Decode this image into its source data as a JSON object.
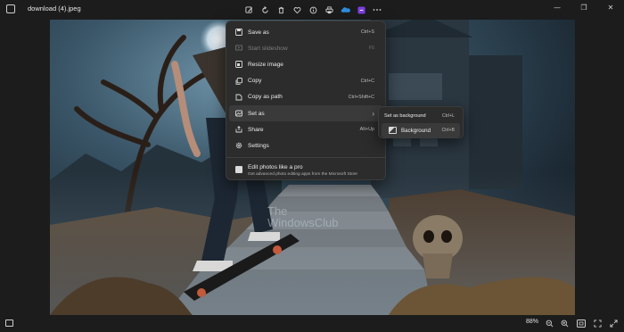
{
  "window": {
    "file_title": "download (4).jpeg",
    "controls": [
      "—",
      "❐",
      "✕"
    ]
  },
  "toolbar": {
    "buttons": [
      "edit-icon",
      "rotate-icon",
      "delete-icon",
      "favorite-icon",
      "info-icon",
      "print-icon",
      "onedrive-icon",
      "clipchamp-icon",
      "more-icon"
    ]
  },
  "menu": {
    "items": [
      {
        "label": "Save as",
        "shortcut": "Ctrl+S",
        "icon": "save-icon"
      },
      {
        "label": "Start slideshow",
        "shortcut": "F5",
        "icon": "slideshow-icon",
        "disabled": true
      },
      {
        "label": "Resize image",
        "shortcut": "",
        "icon": "resize-icon"
      },
      {
        "label": "Copy",
        "shortcut": "Ctrl+C",
        "icon": "copy-icon"
      },
      {
        "label": "Copy as path",
        "shortcut": "Ctrl+Shift+C",
        "icon": "copy-path-icon"
      },
      {
        "label": "Set as",
        "shortcut": "›",
        "icon": "set-as-icon"
      },
      {
        "label": "Share",
        "shortcut": "Alt+Up",
        "icon": "share-icon"
      },
      {
        "label": "Settings",
        "shortcut": "",
        "icon": "settings-icon"
      }
    ],
    "promo_title": "Edit photos like a pro",
    "promo_subtitle": "Get advanced photo editing apps from the Microsoft Store"
  },
  "submenu": {
    "item1_label": "Set as background",
    "item1_shortcut": "Ctrl+L",
    "item2_label": "Background",
    "item2_shortcut": "Ctrl+B"
  },
  "watermark": {
    "line1": "The",
    "line2": "WindowsClub"
  },
  "status": {
    "zoom": "88%"
  }
}
